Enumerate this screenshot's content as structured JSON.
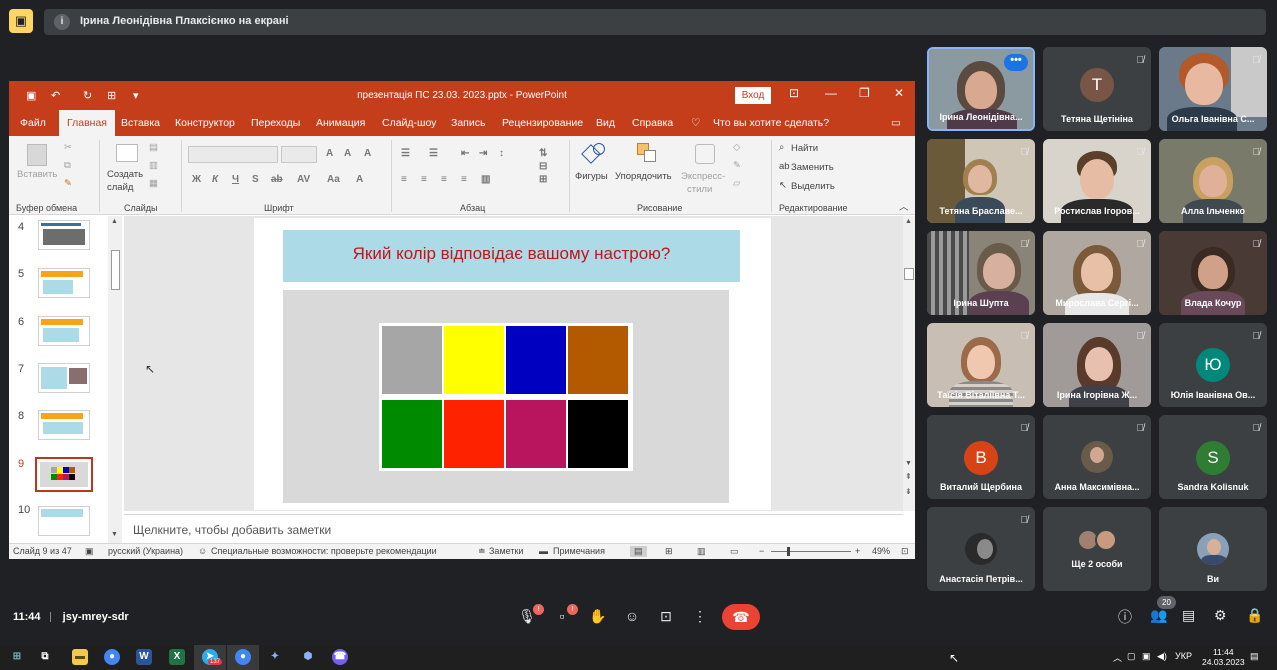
{
  "meet": {
    "presenting_banner": "Ірина Леонідівна Плаксієнко на екрані",
    "info_icon_letter": "i",
    "meeting_time": "11:44",
    "meeting_code": "jsy-mrey-sdr",
    "participant_count": "20",
    "badge_mic": "!",
    "badge_cam": "!"
  },
  "ppt": {
    "window_title": "презентація ПС 23.03. 2023.pptx  -  PowerPoint",
    "login_button": "Вход",
    "tabs": [
      "Файл",
      "Главная",
      "Вставка",
      "Конструктор",
      "Переходы",
      "Анимация",
      "Слайд-шоу",
      "Запись",
      "Рецензирование",
      "Вид",
      "Справка"
    ],
    "tell_me": "Что вы хотите сделать?",
    "ribbon": {
      "paste": "Вставить",
      "create_slide": "Создать",
      "create_slide2": "слайд",
      "shapes": "Фигуры",
      "arrange": "Упорядочить",
      "quick_styles": "Экспресс-",
      "quick_styles2": "стили",
      "find": "Найти",
      "replace": "Заменить",
      "select": "Выделить",
      "groups": [
        "Буфер обмена",
        "Слайды",
        "Шрифт",
        "Абзац",
        "Рисование",
        "Редактирование"
      ],
      "font_buttons": [
        "Ж",
        "К",
        "Ч",
        "S",
        "ab",
        "AV",
        "Aa",
        "A"
      ]
    },
    "thumbnails": [
      {
        "num": "4"
      },
      {
        "num": "5"
      },
      {
        "num": "6"
      },
      {
        "num": "7"
      },
      {
        "num": "8"
      },
      {
        "num": "9"
      },
      {
        "num": "10"
      }
    ],
    "slide": {
      "title": "Який колір відповідає вашому настрою?",
      "swatches": [
        "#a6a6a6",
        "#ffff00",
        "#0000c0",
        "#b35900",
        "#008a00",
        "#ff2200",
        "#b8155e",
        "#000000"
      ]
    },
    "notes_placeholder": "Щелкните, чтобы добавить заметки",
    "status": {
      "slide_of": "Слайд 9 из 47",
      "language": "русский (Украина)",
      "accessibility": "Специальные возможности: проверьте рекомендации",
      "notes": "Заметки",
      "comments": "Примечания",
      "zoom": "49%"
    }
  },
  "participants": [
    {
      "name": "Ірина Леонідівна...",
      "type": "video"
    },
    {
      "name": "Тетяна Щетініна",
      "type": "avatar",
      "letter": "Т",
      "color": "#795548"
    },
    {
      "name": "Ольга Іванівна С...",
      "type": "video"
    },
    {
      "name": "Тетяна Браславе...",
      "type": "video"
    },
    {
      "name": "Ростислав Ігоров...",
      "type": "video"
    },
    {
      "name": "Алла Ільченко",
      "type": "video"
    },
    {
      "name": "Ірина Шупта",
      "type": "video"
    },
    {
      "name": "Мирослава Сергі...",
      "type": "video"
    },
    {
      "name": "Влада Кочур",
      "type": "video"
    },
    {
      "name": "Таїсія Віталіївна Т...",
      "type": "video"
    },
    {
      "name": "Ірина Ігорівна Ж...",
      "type": "video"
    },
    {
      "name": "Юлія Іванівна Ов...",
      "type": "avatar",
      "letter": "Ю",
      "color": "#00897b"
    },
    {
      "name": "Виталий Щербина",
      "type": "avatar",
      "letter": "В",
      "color": "#d84315"
    },
    {
      "name": "Анна Максимівна...",
      "type": "photo"
    },
    {
      "name": "Sandra Kolisnuk",
      "type": "avatar",
      "letter": "S",
      "color": "#2e7d32"
    },
    {
      "name": "Анастасія Петрів...",
      "type": "photo"
    },
    {
      "name": "Ще 2 особи",
      "type": "group"
    },
    {
      "name": "Ви",
      "type": "photo"
    }
  ],
  "taskbar": {
    "language": "УКР",
    "time": "11:44",
    "date": "24.03.2023",
    "telegram_badge": "137"
  },
  "colors": {
    "ppt_accent": "#c43e1c",
    "meet_bg": "#202124",
    "tile_bg": "#3c4043",
    "end_call": "#ea4335"
  }
}
